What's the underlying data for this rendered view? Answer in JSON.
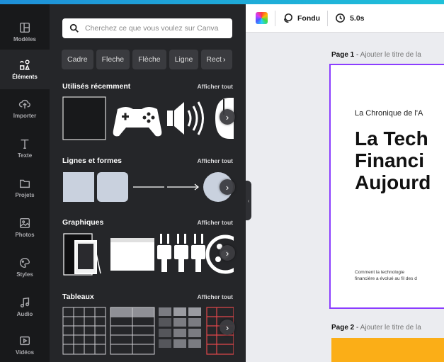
{
  "rail": {
    "items": [
      {
        "label": "Modèles",
        "icon": "template-icon"
      },
      {
        "label": "Éléments",
        "icon": "elements-icon"
      },
      {
        "label": "Importer",
        "icon": "upload-cloud-icon"
      },
      {
        "label": "Texte",
        "icon": "text-icon"
      },
      {
        "label": "Projets",
        "icon": "folder-icon"
      },
      {
        "label": "Photos",
        "icon": "image-icon"
      },
      {
        "label": "Styles",
        "icon": "palette-icon"
      },
      {
        "label": "Audio",
        "icon": "music-note-icon"
      },
      {
        "label": "Vidéos",
        "icon": "video-icon"
      }
    ]
  },
  "search": {
    "placeholder": "Cherchez ce que vous voulez sur Canva"
  },
  "chips": [
    "Cadre",
    "Fleche",
    "Flèche",
    "Ligne",
    "Rect"
  ],
  "sections": {
    "recent": {
      "title": "Utilisés récemment",
      "see_all": "Afficher tout"
    },
    "lines": {
      "title": "Lignes et formes",
      "see_all": "Afficher tout"
    },
    "graphics": {
      "title": "Graphiques",
      "see_all": "Afficher tout"
    },
    "tables": {
      "title": "Tableaux",
      "see_all": "Afficher tout"
    }
  },
  "toolbar": {
    "transition": "Fondu",
    "duration": "5.0s"
  },
  "pages": [
    {
      "number": "Page 1",
      "hint": "Ajouter le titre de la"
    },
    {
      "number": "Page 2",
      "hint": "Ajouter le titre de la"
    }
  ],
  "document": {
    "kicker": "La Chronique de l'A",
    "headline": "La Tech\nFinanci\nAujourd",
    "small_line1": "Comment la technologie",
    "small_line2": "financière a évolué au fil des d"
  },
  "colors": {
    "accent": "#8b3dff",
    "panel": "#252629",
    "rail": "#18191b",
    "page2_fill": "#fbae17"
  }
}
